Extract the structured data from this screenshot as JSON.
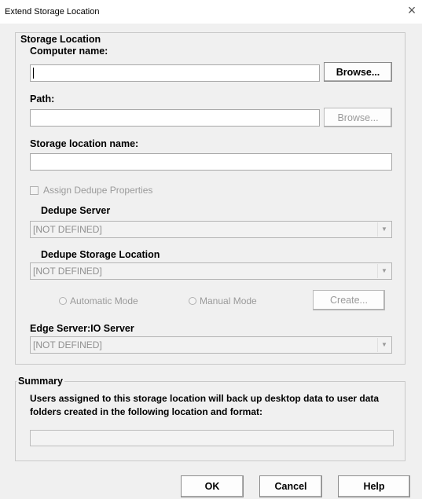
{
  "window": {
    "title": "Extend Storage Location",
    "close_symbol": "×"
  },
  "storage_location": {
    "group_label": "Storage Location",
    "computer_name_label": "Computer name:",
    "computer_name_value": "",
    "browse_label": "Browse...",
    "path_label": "Path:",
    "path_value": "",
    "path_browse_label": "Browse...",
    "storage_name_label": "Storage location name:",
    "storage_name_value": "",
    "assign_dedupe_label": "Assign Dedupe Properties",
    "dedupe_server_label": "Dedupe Server",
    "dedupe_server_value": "[NOT DEFINED]",
    "dedupe_storage_label": "Dedupe Storage Location",
    "dedupe_storage_value": "[NOT DEFINED]",
    "automatic_mode_label": "Automatic Mode",
    "manual_mode_label": "Manual Mode",
    "create_label": "Create...",
    "edge_server_label": "Edge Server:IO Server",
    "edge_server_value": "[NOT DEFINED]"
  },
  "summary": {
    "group_label": "Summary",
    "description": "Users assigned to this storage location will back up desktop data to user data folders created in the following location and format:",
    "format_value": ""
  },
  "buttons": {
    "ok": "OK",
    "cancel": "Cancel",
    "help": "Help"
  },
  "icons": {
    "close": "close-icon",
    "dropdown": "chevron-down-icon"
  },
  "colors": {
    "background": "#f0f0f0",
    "disabled_text": "#9a9a9a"
  }
}
